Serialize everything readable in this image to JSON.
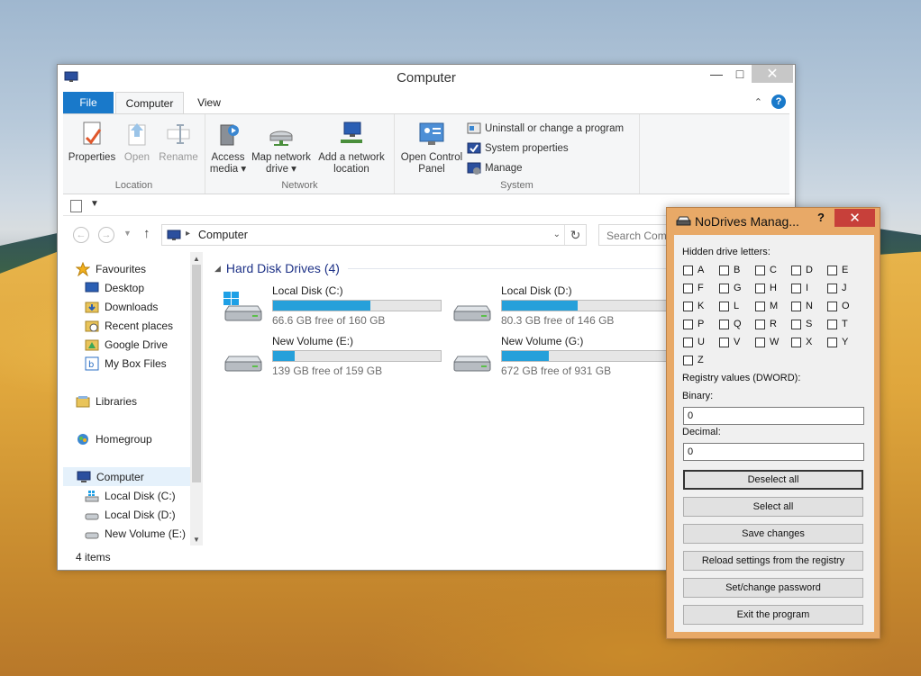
{
  "explorer": {
    "title": "Computer",
    "tabs": [
      "File",
      "Computer",
      "View"
    ],
    "ribbon": {
      "location": {
        "label": "Location",
        "buttons": [
          "Properties",
          "Open",
          "Rename"
        ]
      },
      "network": {
        "label": "Network",
        "access_media": "Access media",
        "map_network_drive": "Map network drive",
        "add_network_location": "Add a network location"
      },
      "system": {
        "label": "System",
        "open_control_panel": "Open Control Panel",
        "uninstall": "Uninstall or change a program",
        "system_properties": "System properties",
        "manage": "Manage"
      }
    },
    "address": {
      "crumb": "Computer",
      "search_placeholder": "Search Computer"
    },
    "nav": {
      "favourites": "Favourites",
      "desktop": "Desktop",
      "downloads": "Downloads",
      "recent_places": "Recent places",
      "google_drive": "Google Drive",
      "my_box_files": "My Box Files",
      "libraries": "Libraries",
      "homegroup": "Homegroup",
      "computer": "Computer",
      "local_c": "Local Disk (C:)",
      "local_d": "Local Disk (D:)",
      "new_volume_e": "New Volume (E:)"
    },
    "group_heading": "Hard Disk Drives (4)",
    "drives": [
      {
        "name": "Local Disk (C:)",
        "free": "66.6 GB free of 160 GB",
        "used_fraction": 0.58,
        "system": true
      },
      {
        "name": "Local Disk (D:)",
        "free": "80.3 GB free of 146 GB",
        "used_fraction": 0.45,
        "system": false
      },
      {
        "name": "New Volume (E:)",
        "free": "139 GB free of 159 GB",
        "used_fraction": 0.13,
        "system": false
      },
      {
        "name": "New Volume (G:)",
        "free": "672 GB free of 931 GB",
        "used_fraction": 0.28,
        "system": false
      }
    ],
    "status": "4 items"
  },
  "nodrives": {
    "title": "NoDrives Manag...",
    "help": "?",
    "hidden_label": "Hidden drive letters:",
    "letters": [
      "A",
      "B",
      "C",
      "D",
      "E",
      "F",
      "G",
      "H",
      "I",
      "J",
      "K",
      "L",
      "M",
      "N",
      "O",
      "P",
      "Q",
      "R",
      "S",
      "T",
      "U",
      "V",
      "W",
      "X",
      "Y",
      "Z"
    ],
    "registry_label": "Registry values (DWORD):",
    "binary_label": "Binary:",
    "binary_value": "0",
    "decimal_label": "Decimal:",
    "decimal_value": "0",
    "buttons": {
      "deselect_all": "Deselect all",
      "select_all": "Select all",
      "save_changes": "Save changes",
      "reload": "Reload settings from the registry",
      "set_password": "Set/change password",
      "exit": "Exit the program"
    }
  },
  "colors": {
    "accent": "#1979ca",
    "drive_bar": "#26a0da",
    "dialog_frame": "#e8a967",
    "close_red": "#c7403a"
  }
}
